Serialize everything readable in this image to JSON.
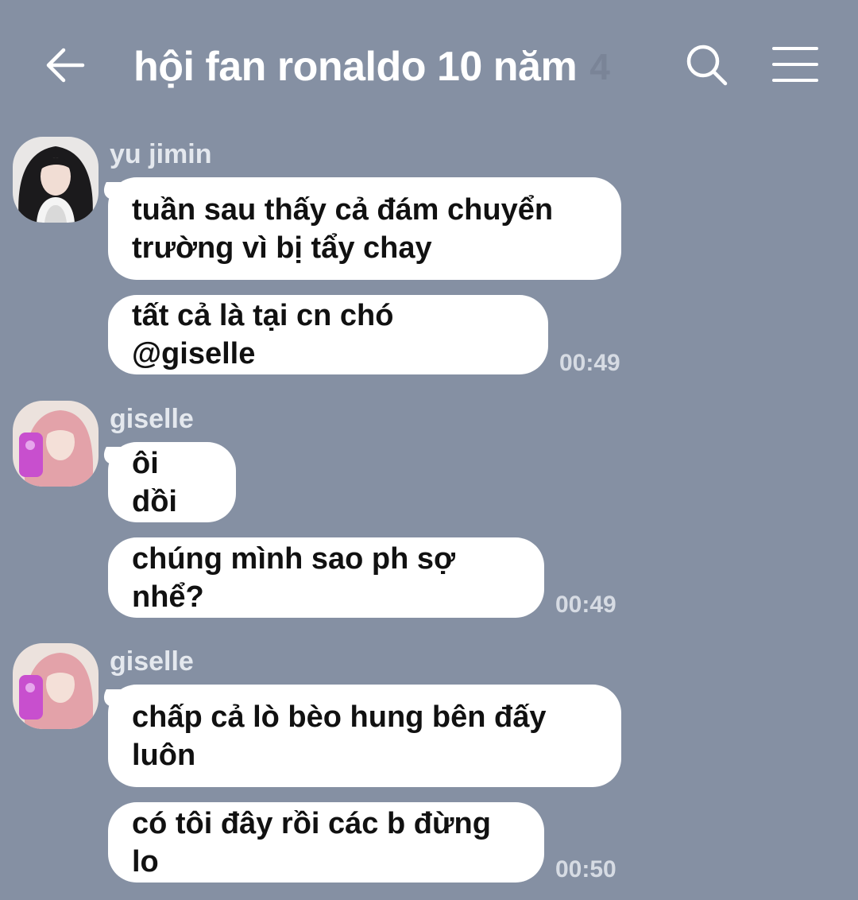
{
  "header": {
    "title": "hội fan ronaldo 10 năm",
    "member_count": "4",
    "back_icon": "arrow-left-icon",
    "search_icon": "search-icon",
    "menu_icon": "hamburger-menu-icon"
  },
  "messages": [
    {
      "sender": "yu jimin",
      "bubbles": [
        "tuần sau thấy cả đám chuyển trường vì bị tẩy chay",
        "tất cả là tại cn chó @giselle"
      ],
      "time": "00:49"
    },
    {
      "sender": "giselle",
      "bubbles": [
        "ôi dồi",
        "chúng mình sao ph sợ nhể?"
      ],
      "time": "00:49"
    },
    {
      "sender": "giselle",
      "bubbles": [
        "chấp cả lò bèo hung bên đấy luôn",
        "có tôi đây rồi các b đừng lo"
      ],
      "time": "00:50"
    }
  ],
  "colors": {
    "background": "#8590a3",
    "bubble": "#ffffff",
    "text": "#111111",
    "sender_name": "#e4e8ee",
    "timestamp": "#d6dbe3"
  }
}
